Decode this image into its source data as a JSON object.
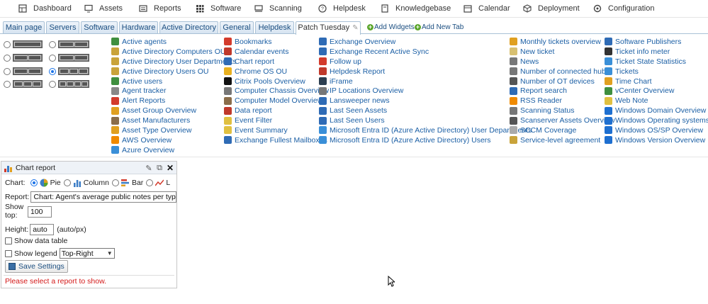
{
  "nav": [
    {
      "label": "Dashboard",
      "icon": "dashboard-icon"
    },
    {
      "label": "Assets",
      "icon": "monitor-icon"
    },
    {
      "label": "Reports",
      "icon": "report-icon"
    },
    {
      "label": "Software",
      "icon": "grid-icon"
    },
    {
      "label": "Scanning",
      "icon": "scan-icon"
    },
    {
      "label": "Helpdesk",
      "icon": "help-icon"
    },
    {
      "label": "Knowledgebase",
      "icon": "book-icon"
    },
    {
      "label": "Calendar",
      "icon": "calendar-icon"
    },
    {
      "label": "Deployment",
      "icon": "cube-icon"
    },
    {
      "label": "Configuration",
      "icon": "gear-icon"
    }
  ],
  "tabs": [
    {
      "label": "Main page",
      "active": false
    },
    {
      "label": "Servers",
      "active": false
    },
    {
      "label": "Software",
      "active": false
    },
    {
      "label": "Hardware",
      "active": false
    },
    {
      "label": "Active Directory",
      "active": false
    },
    {
      "label": "General",
      "active": false
    },
    {
      "label": "Helpdesk",
      "active": false
    },
    {
      "label": "Patch Tuesday",
      "active": true
    }
  ],
  "tab_actions": {
    "add_widgets": "Add Widgets",
    "add_new_tab": "Add New Tab"
  },
  "layout_options": {
    "selected_index": 5
  },
  "widgets": {
    "col1": [
      {
        "label": "Active agents",
        "color": "#3f8f3f"
      },
      {
        "label": "Active Directory Computers OU",
        "color": "#c9a33a"
      },
      {
        "label": "Active Directory User Departments",
        "color": "#c9a33a"
      },
      {
        "label": "Active Directory Users OU",
        "color": "#c9a33a"
      },
      {
        "label": "Active users",
        "color": "#3f8f3f"
      },
      {
        "label": "Agent tracker",
        "color": "#888888"
      },
      {
        "label": "Alert Reports",
        "color": "#d33b2c"
      },
      {
        "label": "Asset Group Overview",
        "color": "#e0a020"
      },
      {
        "label": "Asset Manufacturers",
        "color": "#8a6d4a"
      },
      {
        "label": "Asset Type Overview",
        "color": "#e0a020"
      },
      {
        "label": "AWS Overview",
        "color": "#f08a00"
      },
      {
        "label": "Azure Overview",
        "color": "#3a8fd8"
      }
    ],
    "col2": [
      {
        "label": "Bookmarks",
        "color": "#d33b2c"
      },
      {
        "label": "Calendar events",
        "color": "#c0392b"
      },
      {
        "label": "Chart report",
        "color": "#2f6bb5"
      },
      {
        "label": "Chrome OS OU",
        "color": "#e8b020"
      },
      {
        "label": "Citrix Pools Overview",
        "color": "#111111"
      },
      {
        "label": "Computer Chassis Overview",
        "color": "#777777"
      },
      {
        "label": "Computer Model Overview",
        "color": "#8a6d4a"
      },
      {
        "label": "Data report",
        "color": "#c0392b"
      },
      {
        "label": "Event Filter",
        "color": "#e0c040"
      },
      {
        "label": "Event Summary",
        "color": "#e0c040"
      },
      {
        "label": "Exchange Fullest Mailboxes",
        "color": "#2f6bb5"
      }
    ],
    "col3": [
      {
        "label": "Exchange Overview",
        "color": "#2f6bb5"
      },
      {
        "label": "Exchange Recent Active Sync",
        "color": "#2f6bb5"
      },
      {
        "label": "Follow up",
        "color": "#d33b2c"
      },
      {
        "label": "Helpdesk Report",
        "color": "#c0392b"
      },
      {
        "label": "iFrame",
        "color": "#2c3e50"
      },
      {
        "label": "IP Locations Overview",
        "color": "#777777"
      },
      {
        "label": "Lansweeper news",
        "color": "#2f6bb5"
      },
      {
        "label": "Last Seen Assets",
        "color": "#2f6bb5"
      },
      {
        "label": "Last Seen Users",
        "color": "#2f6bb5"
      },
      {
        "label": "Microsoft Entra ID (Azure Active Directory) User Departments",
        "color": "#3a8fd8"
      },
      {
        "label": "Microsoft Entra ID (Azure Active Directory) Users",
        "color": "#3a8fd8"
      }
    ],
    "col4": [
      {
        "label": "Monthly tickets overview",
        "color": "#e0a020"
      },
      {
        "label": "New ticket",
        "color": "#d8c070"
      },
      {
        "label": "News",
        "color": "#777777"
      },
      {
        "label": "Number of connected hubs",
        "color": "#777777"
      },
      {
        "label": "Number of OT devices",
        "color": "#555555"
      },
      {
        "label": "Report search",
        "color": "#2f6bb5"
      },
      {
        "label": "RSS Reader",
        "color": "#f08a00"
      },
      {
        "label": "Scanning Status",
        "color": "#777777"
      },
      {
        "label": "Scanserver Assets Overview",
        "color": "#555555"
      },
      {
        "label": "SCCM Coverage",
        "color": "#aaaaaa"
      },
      {
        "label": "Service-level agreement",
        "color": "#c9a33a"
      }
    ],
    "col5": [
      {
        "label": "Software Publishers",
        "color": "#2f6bb5"
      },
      {
        "label": "Ticket info meter",
        "color": "#333333"
      },
      {
        "label": "Ticket State Statistics",
        "color": "#3a8fd8"
      },
      {
        "label": "Tickets",
        "color": "#3a8fd8"
      },
      {
        "label": "Time Chart",
        "color": "#e0a020"
      },
      {
        "label": "vCenter Overview",
        "color": "#3f8f3f"
      },
      {
        "label": "Web Note",
        "color": "#e0c040"
      },
      {
        "label": "Windows Domain Overview",
        "color": "#1e6fd0"
      },
      {
        "label": "Windows Operating systems",
        "color": "#1e6fd0"
      },
      {
        "label": "Windows OS/SP Overview",
        "color": "#1e6fd0"
      },
      {
        "label": "Windows Version Overview",
        "color": "#1e6fd0"
      }
    ]
  },
  "panel": {
    "title": "Chart report",
    "chart_label": "Chart:",
    "chart_options": [
      "Pie",
      "Column",
      "Bar",
      "L"
    ],
    "chart_selected": "Pie",
    "report_label": "Report:",
    "report_value": "Chart: Agent's average public notes per type b",
    "show_top_label_1": "Show",
    "show_top_label_2": "top:",
    "show_top_value": "100",
    "height_label": "Height:",
    "height_value": "auto",
    "height_hint": "(auto/px)",
    "show_data_table": "Show data table",
    "show_legend": "Show legend",
    "legend_position": "Top-Right",
    "save_button": "Save Settings",
    "message": "Please select a report to show."
  }
}
